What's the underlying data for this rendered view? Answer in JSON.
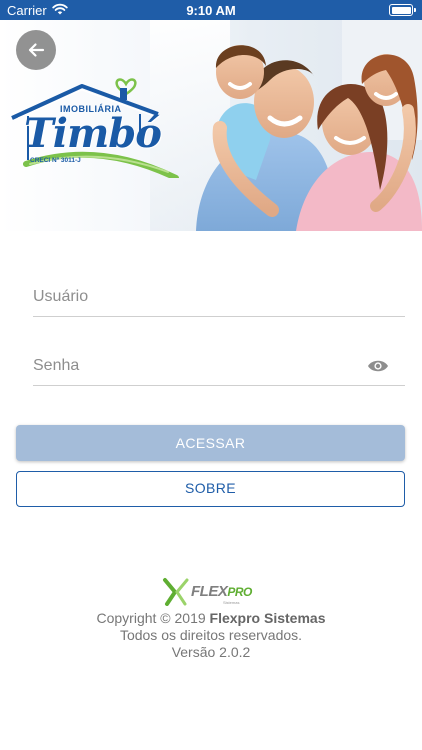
{
  "status_bar": {
    "carrier": "Carrier",
    "time": "9:10 AM",
    "wifi_icon": "wifi-icon",
    "battery_icon": "battery-icon"
  },
  "header": {
    "back_icon": "arrow-left-icon",
    "logo": {
      "top_text": "IMOBILIÁRIA",
      "main_text": "Timbó",
      "creci_text": "CRECI Nº 3011-J"
    }
  },
  "login_form": {
    "username": {
      "placeholder": "Usuário",
      "value": ""
    },
    "password": {
      "placeholder": "Senha",
      "value": "",
      "toggle_icon": "eye-icon"
    },
    "login_button_label": "ACESSAR",
    "about_button_label": "SOBRE"
  },
  "footer": {
    "logo": {
      "flex": "FLEX",
      "pro": "PRO",
      "tagline": "Sistemas"
    },
    "copyright_prefix": "Copyright © 2019",
    "company": "Flexpro Sistemas",
    "rights": "Todos os direitos reservados.",
    "version": "Versão 2.0.2"
  },
  "colors": {
    "primary": "#1f5da8",
    "button_disabled": "#a4bcd9",
    "logo_green": "#7cc24a",
    "text_muted": "#777777"
  }
}
